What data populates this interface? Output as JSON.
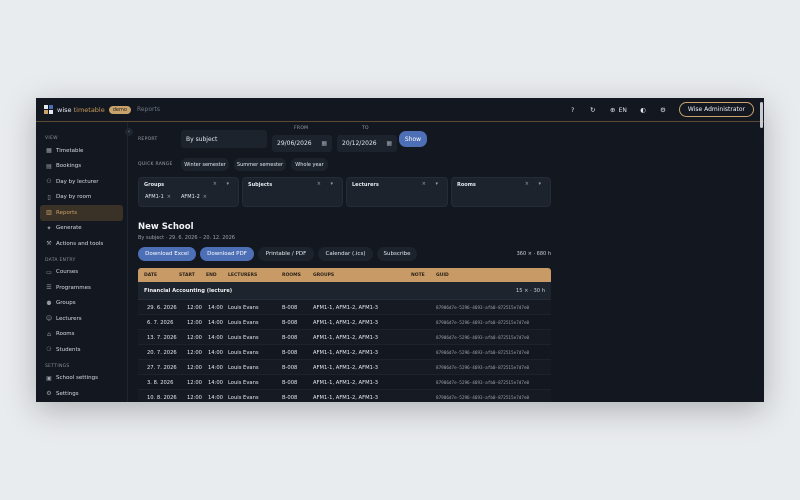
{
  "topbar": {
    "brand_main": "wise",
    "brand_accent": "timetable",
    "badge": "demo",
    "breadcrumb": "Reports",
    "help": "?",
    "lang": "EN",
    "user": "Wise Administrator",
    "logo_colors": [
      "#e4e8ee",
      "#4d6fb6",
      "#c9a26c",
      "#e4e8ee"
    ]
  },
  "sidebar": {
    "view_label": "VIEW",
    "view_items": [
      {
        "label": "Timetable",
        "icon": "grid-icon"
      },
      {
        "label": "Bookings",
        "icon": "calendar-icon"
      },
      {
        "label": "Day by lecturer",
        "icon": "user-icon"
      },
      {
        "label": "Day by room",
        "icon": "door-icon"
      },
      {
        "label": "Reports",
        "icon": "report-icon",
        "active": true
      },
      {
        "label": "Generate",
        "icon": "sparkle-icon"
      },
      {
        "label": "Actions and tools",
        "icon": "wrench-icon"
      }
    ],
    "entry_label": "DATA ENTRY",
    "entry_items": [
      {
        "label": "Courses",
        "icon": "book-icon"
      },
      {
        "label": "Programmes",
        "icon": "stack-icon"
      },
      {
        "label": "Groups",
        "icon": "users-icon"
      },
      {
        "label": "Lecturers",
        "icon": "lecturer-icon"
      },
      {
        "label": "Rooms",
        "icon": "room-icon"
      },
      {
        "label": "Students",
        "icon": "student-icon"
      }
    ],
    "settings_label": "SETTINGS",
    "settings_items": [
      {
        "label": "School settings",
        "icon": "school-icon"
      },
      {
        "label": "Settings",
        "icon": "gear-icon"
      }
    ]
  },
  "report": {
    "label": "REPORT",
    "value": "By subject",
    "from_label": "FROM",
    "from_value": "29/06/2026",
    "to_label": "TO",
    "to_value": "20/12/2026",
    "show": "Show"
  },
  "quick_range": {
    "label": "QUICK RANGE",
    "options": [
      "Winter semester",
      "Summer semester",
      "Whole year"
    ]
  },
  "filters": [
    {
      "title": "Groups",
      "chips": [
        "AFM1-1",
        "AFM1-2"
      ]
    },
    {
      "title": "Subjects",
      "chips": []
    },
    {
      "title": "Lecturers",
      "chips": []
    },
    {
      "title": "Rooms",
      "chips": []
    }
  ],
  "school": {
    "title": "New School",
    "subtitle": "By subject · 29. 6. 2026 – 20. 12. 2026"
  },
  "actions": [
    "Download Excel",
    "Download PDF",
    "Printable / PDF",
    "Calendar (.ics)",
    "Subscribe"
  ],
  "totals": "360 × · 680 h",
  "table": {
    "columns": [
      "DATE",
      "START",
      "END",
      "LECTURERS",
      "ROOMS",
      "GROUPS",
      "NOTE",
      "GUID"
    ],
    "group_title": "Financial Accounting (lecture)",
    "group_count": "15 × · 30 h",
    "rows": [
      {
        "date": "29. 6. 2026",
        "start": "12:00",
        "end": "14:00",
        "lecturer": "Louis Evans",
        "room": "B-008",
        "groups": "AFM1-1, AFM1-2, AFM1-3",
        "guid": "87906d7e-5296-4693-afb0-872515e7d7e0"
      },
      {
        "date": "6. 7. 2026",
        "start": "12:00",
        "end": "14:00",
        "lecturer": "Louis Evans",
        "room": "B-008",
        "groups": "AFM1-1, AFM1-2, AFM1-3",
        "guid": "87906d7e-5296-4693-afb0-872515e7d7e0"
      },
      {
        "date": "13. 7. 2026",
        "start": "12:00",
        "end": "14:00",
        "lecturer": "Louis Evans",
        "room": "B-008",
        "groups": "AFM1-1, AFM1-2, AFM1-3",
        "guid": "87906d7e-5296-4693-afb0-872515e7d7e0"
      },
      {
        "date": "20. 7. 2026",
        "start": "12:00",
        "end": "14:00",
        "lecturer": "Louis Evans",
        "room": "B-008",
        "groups": "AFM1-1, AFM1-2, AFM1-3",
        "guid": "87906d7e-5296-4693-afb0-872515e7d7e0"
      },
      {
        "date": "27. 7. 2026",
        "start": "12:00",
        "end": "14:00",
        "lecturer": "Louis Evans",
        "room": "B-008",
        "groups": "AFM1-1, AFM1-2, AFM1-3",
        "guid": "87906d7e-5296-4693-afb0-872515e7d7e0"
      },
      {
        "date": "3. 8. 2026",
        "start": "12:00",
        "end": "14:00",
        "lecturer": "Louis Evans",
        "room": "B-008",
        "groups": "AFM1-1, AFM1-2, AFM1-3",
        "guid": "87906d7e-5296-4693-afb0-872515e7d7e0"
      },
      {
        "date": "10. 8. 2026",
        "start": "12:00",
        "end": "14:00",
        "lecturer": "Louis Evans",
        "room": "B-008",
        "groups": "AFM1-1, AFM1-2, AFM1-3",
        "guid": "87906d7e-5296-4693-afb0-872515e7d7e0"
      }
    ]
  }
}
